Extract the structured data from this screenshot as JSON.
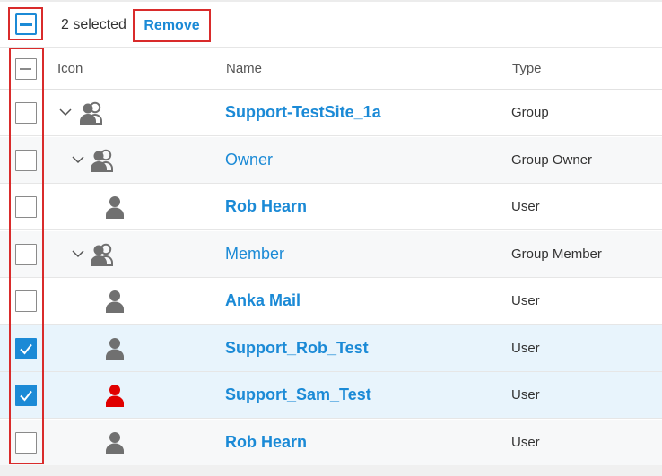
{
  "toolbar": {
    "selected_count": "2 selected",
    "remove_label": "Remove"
  },
  "columns": {
    "icon": "Icon",
    "name": "Name",
    "type": "Type"
  },
  "colors": {
    "accent": "#1b8ad6",
    "highlight_border": "#d92b2b",
    "selected_row_bg": "#e8f4fc",
    "person_icon_default": "#707070",
    "person_icon_alert": "#e00000"
  },
  "rows": [
    {
      "name": "Support-TestSite_1a",
      "type": "Group",
      "icon": "group-icon",
      "checked": false,
      "expandable": true,
      "level": 0,
      "bold": true
    },
    {
      "name": "Owner",
      "type": "Group Owner",
      "icon": "group-icon",
      "checked": false,
      "expandable": true,
      "level": 1,
      "bold": false
    },
    {
      "name": "Rob Hearn",
      "type": "User",
      "icon": "user-icon",
      "checked": false,
      "expandable": false,
      "level": 2,
      "bold": true
    },
    {
      "name": "Member",
      "type": "Group Member",
      "icon": "group-icon",
      "checked": false,
      "expandable": true,
      "level": 1,
      "bold": false
    },
    {
      "name": "Anka Mail",
      "type": "User",
      "icon": "user-icon",
      "checked": false,
      "expandable": false,
      "level": 2,
      "bold": true
    },
    {
      "name": "Support_Rob_Test",
      "type": "User",
      "icon": "user-icon",
      "checked": true,
      "expandable": false,
      "level": 2,
      "bold": true
    },
    {
      "name": "Support_Sam_Test",
      "type": "User",
      "icon": "user-icon-red",
      "checked": true,
      "expandable": false,
      "level": 2,
      "bold": true
    },
    {
      "name": "Rob Hearn",
      "type": "User",
      "icon": "user-icon",
      "checked": false,
      "expandable": false,
      "level": 2,
      "bold": true
    }
  ]
}
